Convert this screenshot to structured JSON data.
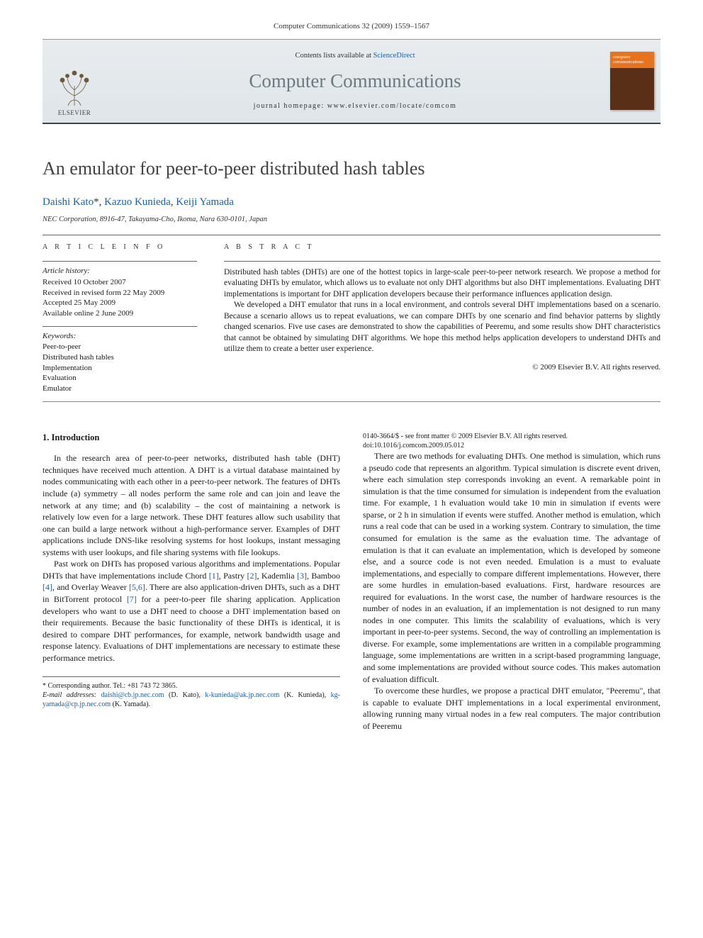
{
  "header_line": "Computer Communications 32 (2009) 1559–1567",
  "banner": {
    "contents_prefix": "Contents lists available at ",
    "contents_link": "ScienceDirect",
    "journal": "Computer Communications",
    "homepage_prefix": "journal homepage: ",
    "homepage": "www.elsevier.com/locate/comcom",
    "publisher": "ELSEVIER",
    "cover_label": "computer communications"
  },
  "title": "An emulator for peer-to-peer distributed hash tables",
  "authors_html": {
    "a1": "Daishi Kato",
    "a1_sup": "*",
    "sep1": ", ",
    "a2": "Kazuo Kunieda",
    "sep2": ", ",
    "a3": "Keiji Yamada"
  },
  "affiliation": "NEC Corporation, 8916-47, Takayama-Cho, Ikoma, Nara 630-0101, Japan",
  "article_info": {
    "head": "A R T I C L E   I N F O",
    "history_label": "Article history:",
    "history": [
      "Received 10 October 2007",
      "Received in revised form 22 May 2009",
      "Accepted 25 May 2009",
      "Available online 2 June 2009"
    ],
    "keywords_label": "Keywords:",
    "keywords": [
      "Peer-to-peer",
      "Distributed hash tables",
      "Implementation",
      "Evaluation",
      "Emulator"
    ]
  },
  "abstract": {
    "head": "A B S T R A C T",
    "p1": "Distributed hash tables (DHTs) are one of the hottest topics in large-scale peer-to-peer network research. We propose a method for evaluating DHTs by emulator, which allows us to evaluate not only DHT algorithms but also DHT implementations. Evaluating DHT implementations is important for DHT application developers because their performance influences application design.",
    "p2": "We developed a DHT emulator that runs in a local environment, and controls several DHT implementations based on a scenario. Because a scenario allows us to repeat evaluations, we can compare DHTs by one scenario and find behavior patterns by slightly changed scenarios. Five use cases are demonstrated to show the capabilities of Peeremu, and some results show DHT characteristics that cannot be obtained by simulating DHT algorithms. We hope this method helps application developers to understand DHTs and utilize them to create a better user experience.",
    "copyright": "© 2009 Elsevier B.V. All rights reserved."
  },
  "body": {
    "h_intro": "1. Introduction",
    "p1": "In the research area of peer-to-peer networks, distributed hash table (DHT) techniques have received much attention. A DHT is a virtual database maintained by nodes communicating with each other in a peer-to-peer network. The features of DHTs include (a) symmetry – all nodes perform the same role and can join and leave the network at any time; and (b) scalability – the cost of maintaining a network is relatively low even for a large network. These DHT features allow such usability that one can build a large network without a high-performance server. Examples of DHT applications include DNS-like resolving systems for host lookups, instant messaging systems with user lookups, and file sharing systems with file lookups.",
    "p2_a": "Past work on DHTs has proposed various algorithms and implementations. Popular DHTs that have implementations include Chord ",
    "ref1": "[1]",
    "p2_b": ", Pastry ",
    "ref2": "[2]",
    "p2_c": ", Kademlia ",
    "ref3": "[3]",
    "p2_d": ", Bamboo ",
    "ref4": "[4]",
    "p2_e": ", and Overlay Weaver ",
    "ref56": "[5,6]",
    "p2_f": ". There are also application-driven DHTs, such as a DHT in BitTorrent protocol ",
    "ref7": "[7]",
    "p2_g": " for a peer-to-peer file sharing application. Application developers who want to use a DHT need to choose a DHT implementation based on their requirements. Because the basic functionality of these DHTs is identical, it is desired to compare DHT performances, for example, network bandwidth usage and response latency. Evaluations of DHT implementations are necessary to estimate these performance metrics.",
    "p3": "There are two methods for evaluating DHTs. One method is simulation, which runs a pseudo code that represents an algorithm. Typical simulation is discrete event driven, where each simulation step corresponds invoking an event. A remarkable point in simulation is that the time consumed for simulation is independent from the evaluation time. For example, 1 h evaluation would take 10 min in simulation if events were sparse, or 2 h in simulation if events were stuffed. Another method is emulation, which runs a real code that can be used in a working system. Contrary to simulation, the time consumed for emulation is the same as the evaluation time. The advantage of emulation is that it can evaluate an implementation, which is developed by someone else, and a source code is not even needed. Emulation is a must to evaluate implementations, and especially to compare different implementations. However, there are some hurdles in emulation-based evaluations. First, hardware resources are required for evaluations. In the worst case, the number of hardware resources is the number of nodes in an evaluation, if an implementation is not designed to run many nodes in one computer. This limits the scalability of evaluations, which is very important in peer-to-peer systems. Second, the way of controlling an implementation is diverse. For example, some implementations are written in a compilable programming language, some implementations are written in a script-based programming language, and some implementations are provided without source codes. This makes automation of evaluation difficult.",
    "p4": "To overcome these hurdles, we propose a practical DHT emulator, \"Peeremu\", that is capable to evaluate DHT implementations in a local experimental environment, allowing running many virtual nodes in a few real computers. The major contribution of Peeremu"
  },
  "footnotes": {
    "corr_label": "* Corresponding author. Tel.: +81 743 72 3865.",
    "email_label": "E-mail addresses:",
    "e1": "daishi@cb.jp.nec.com",
    "n1": " (D. Kato), ",
    "e2": "k-kunieda@ak.jp.nec.com",
    "n2": " (K. Kunieda), ",
    "e3": "kg-yamada@cp.jp.nec.com",
    "n3": " (K. Yamada)."
  },
  "doiblock": {
    "l1": "0140-3664/$ - see front matter © 2009 Elsevier B.V. All rights reserved.",
    "l2": "doi:10.1016/j.comcom.2009.05.012"
  }
}
